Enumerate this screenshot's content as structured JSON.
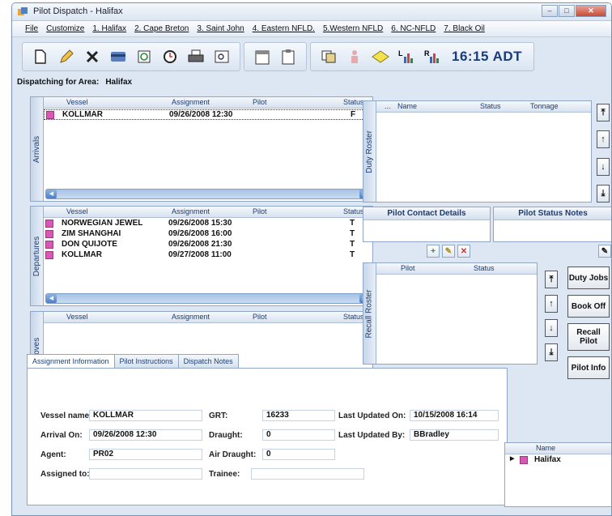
{
  "window": {
    "title": "Pilot Dispatch - Halifax"
  },
  "menu": [
    "File",
    "Customize",
    "1. Halifax",
    "2. Cape Breton",
    "3. Saint John",
    "4. Eastern NFLD.",
    "5.Western NFLD",
    "6. NC-NFLD",
    "7. Black Oil"
  ],
  "clock": "16:15 ADT",
  "area": {
    "label": "Dispatching for Area:",
    "value": "Halifax"
  },
  "columns": {
    "vessel": "Vessel",
    "assignment": "Assignment",
    "pilot": "Pilot",
    "status": "Status",
    "dots": "...",
    "name": "Name",
    "tonnage": "Tonnage"
  },
  "arrivals": {
    "label": "Arrivals",
    "rows": [
      {
        "vessel": "KOLLMAR",
        "assignment": "09/26/2008 12:30",
        "pilot": "",
        "status": "F"
      }
    ]
  },
  "departures": {
    "label": "Departures",
    "rows": [
      {
        "vessel": "NORWEGIAN JEWEL",
        "assignment": "09/26/2008 15:30",
        "pilot": "",
        "status": "T"
      },
      {
        "vessel": "ZIM SHANGHAI",
        "assignment": "09/26/2008 16:00",
        "pilot": "",
        "status": "T"
      },
      {
        "vessel": "DON QUIJOTE",
        "assignment": "09/26/2008 21:30",
        "pilot": "",
        "status": "T"
      },
      {
        "vessel": "KOLLMAR",
        "assignment": "09/27/2008 11:00",
        "pilot": "",
        "status": "T"
      }
    ]
  },
  "moves": {
    "label": "Moves"
  },
  "duty_roster": {
    "label": "Duty Roster"
  },
  "recall_roster": {
    "label": "Recall Roster"
  },
  "pilot_contact": {
    "title": "Pilot Contact Details"
  },
  "pilot_notes": {
    "title": "Pilot Status Notes"
  },
  "actions": {
    "duty_jobs": "Duty Jobs",
    "book_off": "Book Off",
    "recall_pilot": "Recall Pilot",
    "pilot_info": "Pilot Info"
  },
  "tabs": [
    "Assignment Information",
    "Pilot Instructions",
    "Dispatch Notes"
  ],
  "assignment": {
    "vessel_label": "Vessel name:",
    "vessel": "KOLLMAR",
    "arrival_label": "Arrival On:",
    "arrival": "09/26/2008 12:30",
    "agent_label": "Agent:",
    "agent": "PR02",
    "assigned_label": "Assigned to:",
    "assigned": "",
    "grt_label": "GRT:",
    "grt": "16233",
    "draught_label": "Draught:",
    "draught": "0",
    "air_draught_label": "Air Draught:",
    "air_draught": "0",
    "trainee_label": "Trainee:",
    "trainee": "",
    "updated_on_label": "Last Updated On:",
    "updated_on": "10/15/2008 16:14",
    "updated_by_label": "Last Updated By:",
    "updated_by": "BBradley"
  },
  "area_list": {
    "header": "Name",
    "rows": [
      "Halifax"
    ]
  },
  "colors": {
    "marker": "#d957b5",
    "accent": "#1c3b72"
  }
}
